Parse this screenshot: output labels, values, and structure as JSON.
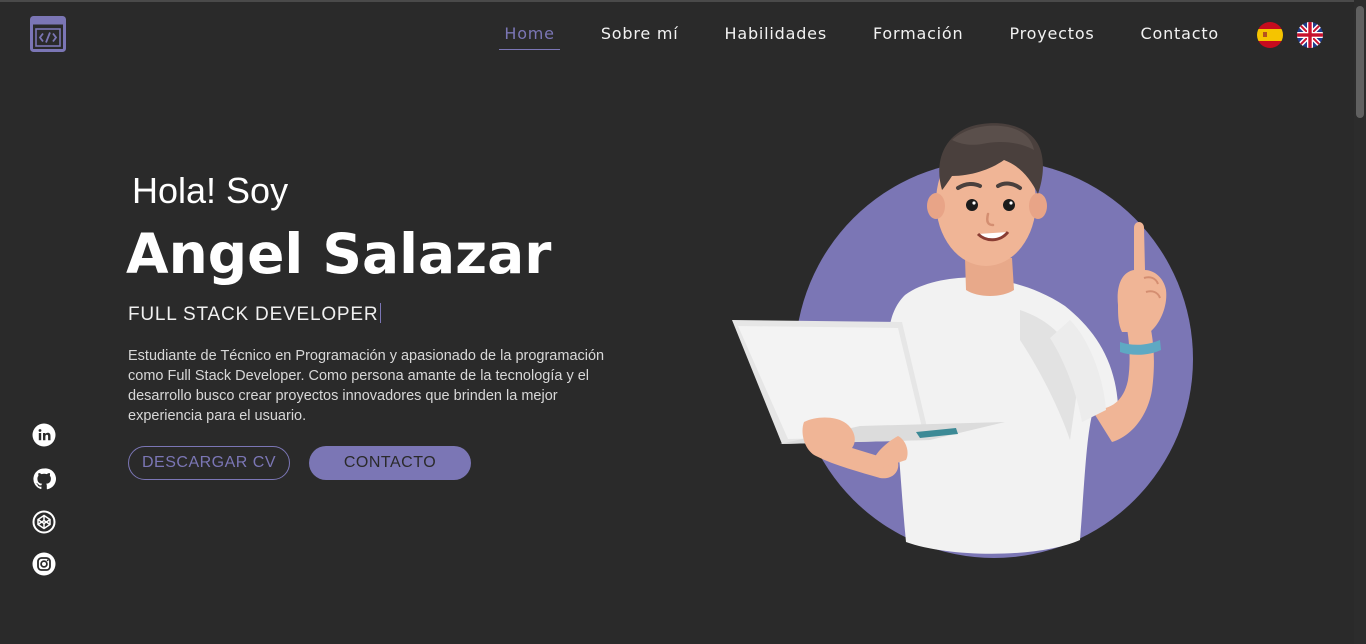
{
  "header": {
    "nav": [
      "Home",
      "Sobre mí",
      "Habilidades",
      "Formación",
      "Proyectos",
      "Contacto"
    ],
    "active_index": 0,
    "languages": [
      {
        "code": "es",
        "icon": "spain-flag-icon"
      },
      {
        "code": "en",
        "icon": "uk-flag-icon"
      }
    ]
  },
  "hero": {
    "greeting": "Hola! Soy",
    "name": "Angel Salazar",
    "role": "FULL STACK DEVELOPER",
    "description": "Estudiante de Técnico en Programación y apasionado de la programación como Full Stack Developer. Como persona amante de la tecnología y el desarrollo busco crear proyectos innovadores que brinden la mejor experiencia para el usuario.",
    "cv_button": "DESCARGAR CV",
    "contact_button": "CONTACTO"
  },
  "social": [
    "linkedin-icon",
    "github-icon",
    "codepen-icon",
    "instagram-icon"
  ],
  "colors": {
    "background": "#2a2a2a",
    "accent": "#7b76b5",
    "text": "#ffffff"
  }
}
